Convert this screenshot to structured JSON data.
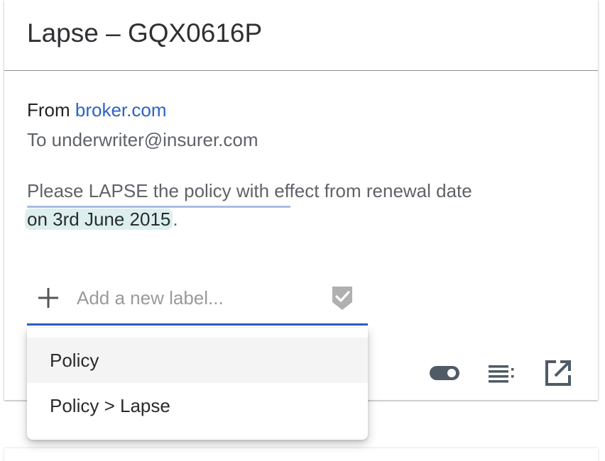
{
  "card": {
    "title": "Lapse – GQX0616P",
    "from_prefix": "From ",
    "from_link": "broker.com",
    "to_line": "To underwriter@insurer.com",
    "message_line1": "Please LAPSE the policy with effect from renewal date",
    "message_highlight": "on 3rd June 2015",
    "message_end": "."
  },
  "label_input": {
    "value": "",
    "placeholder": "Add a new label..."
  },
  "dropdown": {
    "options": [
      {
        "label": "Policy",
        "active": true
      },
      {
        "label": "Policy > Lapse",
        "active": false
      }
    ]
  },
  "icons": {
    "add": "plus-icon",
    "confirm": "check-shield-icon",
    "toggle": "toggle-icon",
    "list": "list-icon",
    "open": "open-in-new-icon"
  },
  "colors": {
    "link": "#2d63c8",
    "accent_underline": "#2a5fc4",
    "highlight_bg": "#dcefee",
    "icon_gray": "#4f5b66"
  }
}
